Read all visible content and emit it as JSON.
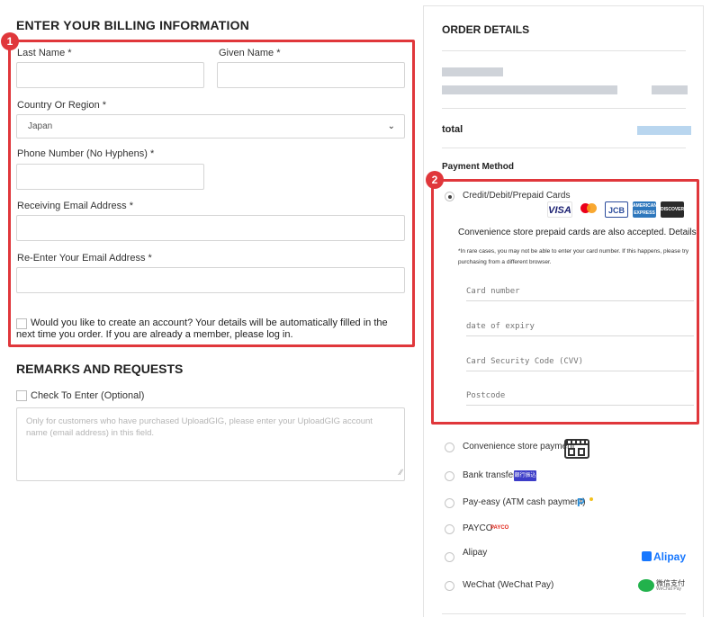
{
  "billing": {
    "heading": "ENTER YOUR BILLING INFORMATION",
    "last_name_label": "Last Name *",
    "given_name_label": "Given Name *",
    "country_label": "Country Or Region *",
    "country_value": "Japan",
    "phone_label": "Phone Number (No Hyphens) *",
    "email_label": "Receiving Email Address *",
    "email_confirm_label": "Re-Enter Your Email Address *",
    "create_account_text": "Would you like to create an account? Your details will be automatically filled in the next time you order. If you are already a member, please log in."
  },
  "remarks": {
    "heading": "REMARKS AND REQUESTS",
    "check_label": "Check To Enter (Optional)",
    "textarea_placeholder": "Only for customers who have purchased UploadGIG, please enter your UploadGIG account name (email address) in this field."
  },
  "badges": {
    "one": "1",
    "two": "2"
  },
  "order": {
    "heading": "ORDER DETAILS",
    "total_label": "total"
  },
  "payment": {
    "heading": "Payment Method",
    "card_option": "Credit/Debit/Prepaid Cards",
    "card_logos": {
      "visa": "VISA",
      "jcb": "JCB",
      "amex": "AMERICAN EXPRESS",
      "discover": "DISCOVER"
    },
    "convenience_note": "Convenience store prepaid cards are also accepted. Details",
    "fine_print": "*In rare cases, you may not be able to enter your card number. If this happens, please try purchasing from a different browser.",
    "card_number_placeholder": "Card number",
    "expiry_placeholder": "date of expiry",
    "cvv_placeholder": "Card Security Code (CVV)",
    "postcode_placeholder": "Postcode",
    "options": {
      "convenience": "Convenience store payment",
      "bank": "Bank transfer",
      "bank_badge": "銀行振込",
      "payeasy": "Pay-easy (ATM cash payment)",
      "payeasy_logo": "P",
      "payco": "PAYCO",
      "payco_logo": "PAYCO",
      "alipay": "Alipay",
      "alipay_logo": "Alipay",
      "wechat": "WeChat (WeChat Pay)",
      "wechat_logo_cn": "微信支付",
      "wechat_logo_en": "WeChat Pay"
    }
  },
  "colors": {
    "highlight": "#e0373b",
    "visa": "#1a1f71",
    "alipay": "#1677ff",
    "wechat": "#22b24c"
  }
}
